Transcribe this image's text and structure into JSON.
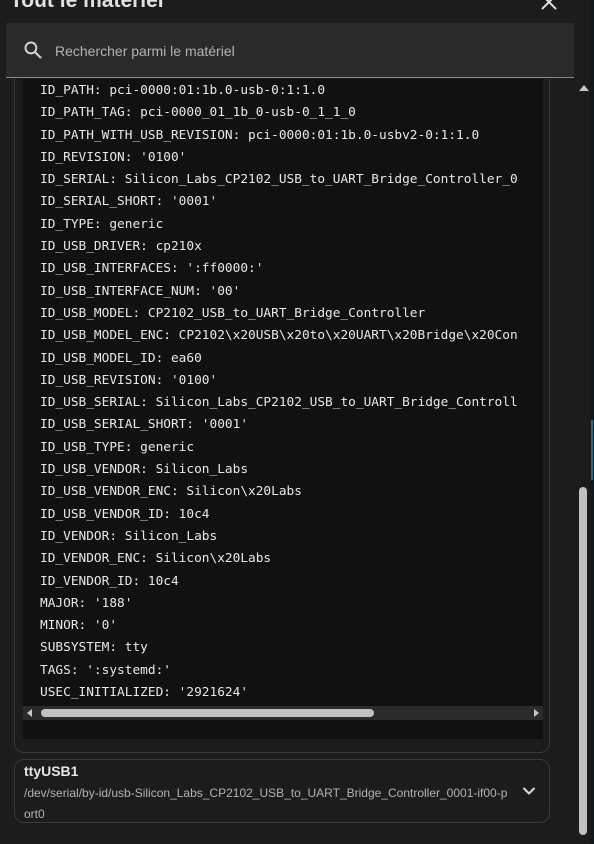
{
  "dialog": {
    "title": "Tout le matériel"
  },
  "search": {
    "placeholder": "Rechercher parmi le matériel"
  },
  "attributes": [
    "ID_PATH: pci-0000:01:1b.0-usb-0:1:1.0",
    "ID_PATH_TAG: pci-0000_01_1b_0-usb-0_1_1_0",
    "ID_PATH_WITH_USB_REVISION: pci-0000:01:1b.0-usbv2-0:1:1.0",
    "ID_REVISION: '0100'",
    "ID_SERIAL: Silicon_Labs_CP2102_USB_to_UART_Bridge_Controller_0",
    "ID_SERIAL_SHORT: '0001'",
    "ID_TYPE: generic",
    "ID_USB_DRIVER: cp210x",
    "ID_USB_INTERFACES: ':ff0000:'",
    "ID_USB_INTERFACE_NUM: '00'",
    "ID_USB_MODEL: CP2102_USB_to_UART_Bridge_Controller",
    "ID_USB_MODEL_ENC: CP2102\\x20USB\\x20to\\x20UART\\x20Bridge\\x20Con",
    "ID_USB_MODEL_ID: ea60",
    "ID_USB_REVISION: '0100'",
    "ID_USB_SERIAL: Silicon_Labs_CP2102_USB_to_UART_Bridge_Controll",
    "ID_USB_SERIAL_SHORT: '0001'",
    "ID_USB_TYPE: generic",
    "ID_USB_VENDOR: Silicon_Labs",
    "ID_USB_VENDOR_ENC: Silicon\\x20Labs",
    "ID_USB_VENDOR_ID: 10c4",
    "ID_VENDOR: Silicon_Labs",
    "ID_VENDOR_ENC: Silicon\\x20Labs",
    "ID_VENDOR_ID: 10c4",
    "MAJOR: '188'",
    "MINOR: '0'",
    "SUBSYSTEM: tty",
    "TAGS: ':systemd:'",
    "USEC_INITIALIZED: '2921624'"
  ],
  "device": {
    "name": "ttyUSB1",
    "path": "/dev/serial/by-id/usb-Silicon_Labs_CP2102_USB_to_UART_Bridge_Controller_0001-if00-port0"
  },
  "icons": {
    "close": "close-icon",
    "search": "search-icon",
    "expand": "chevron-down-icon"
  },
  "colors": {
    "background": "#1c1c1c",
    "code_background": "#111111",
    "text": "#e1e1e1"
  }
}
